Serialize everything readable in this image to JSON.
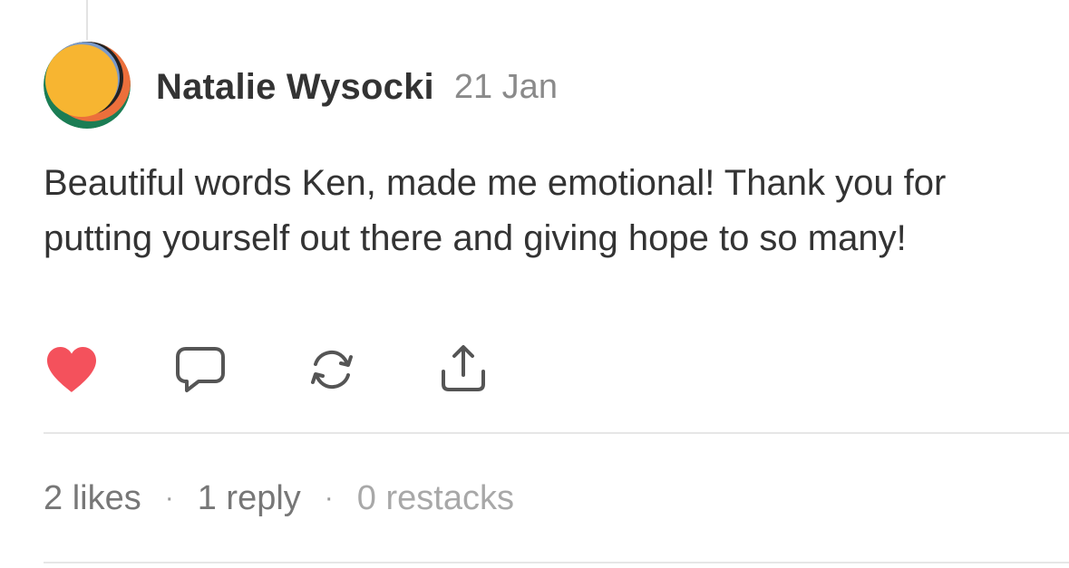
{
  "post": {
    "author": "Natalie Wysocki",
    "date": "21 Jan",
    "body": "Beautiful words Ken, made me emotional! Thank you for putting yourself out there and giving hope to so many!",
    "liked": true
  },
  "icons": {
    "like": "heart-icon",
    "reply": "comment-bubble-icon",
    "restack": "restack-icon",
    "share": "share-icon"
  },
  "stats": {
    "likes": "2 likes",
    "replies": "1 reply",
    "restacks": "0 restacks",
    "separator": "·"
  },
  "colors": {
    "heart": "#f4515c",
    "icon_stroke": "#555555",
    "avatar_yellow": "#f7b531",
    "avatar_green": "#1b7d54",
    "avatar_orange": "#ec6f3b",
    "avatar_blue": "#7a9ac9"
  }
}
